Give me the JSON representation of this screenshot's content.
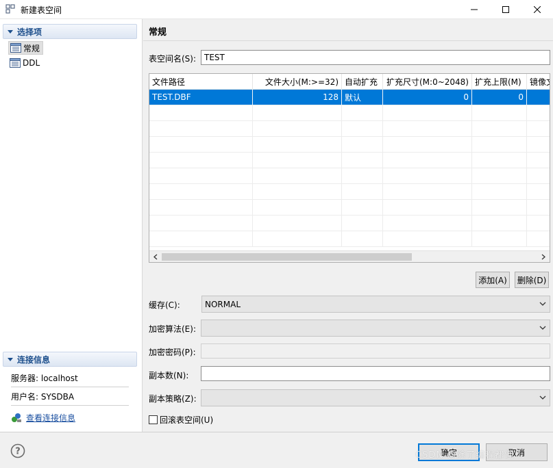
{
  "window": {
    "title": "新建表空间"
  },
  "sidebar": {
    "section_title": "选择项",
    "items": [
      {
        "label": "常规"
      },
      {
        "label": "DDL"
      }
    ]
  },
  "connection_info": {
    "section_title": "连接信息",
    "server_label": "服务器: localhost",
    "user_label": "用户名: SYSDBA",
    "link_label": "查看连接信息"
  },
  "main": {
    "title": "常规",
    "tablespace_name_label": "表空间名(S):",
    "tablespace_name_value": "TEST",
    "table": {
      "columns": [
        "文件路径",
        "文件大小(M:>=32)",
        "自动扩充",
        "扩充尺寸(M:0~2048)",
        "扩充上限(M)",
        "镜像文"
      ],
      "rows": [
        [
          "TEST.DBF",
          "128",
          "默认",
          "0",
          "0",
          ""
        ]
      ]
    },
    "add_button": "添加(A)",
    "delete_button": "删除(D)",
    "cache_label": "缓存(C):",
    "cache_value": "NORMAL",
    "encrypt_algo_label": "加密算法(E):",
    "encrypt_algo_value": "",
    "encrypt_pwd_label": "加密密码(P):",
    "encrypt_pwd_value": "",
    "copies_label": "副本数(N):",
    "copies_value": "",
    "copy_policy_label": "副本策略(Z):",
    "copy_policy_value": "",
    "rollback_label": "回滚表空间(U)"
  },
  "footer": {
    "ok_button": "确定",
    "cancel_button": "取消",
    "watermark": "CSDN @除了编程都懂"
  },
  "colors": {
    "selection": "#0078d7",
    "section_text": "#1d4f8c",
    "link": "#1a4fa0"
  }
}
